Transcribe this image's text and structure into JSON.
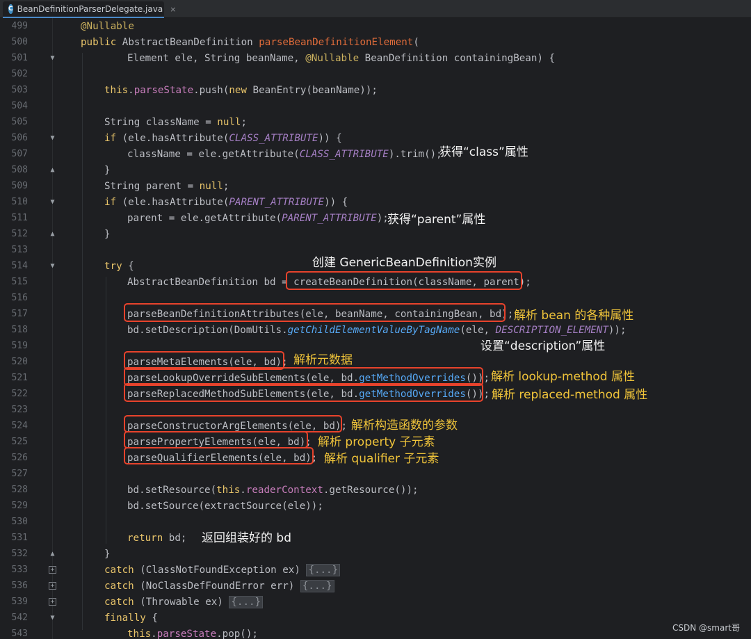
{
  "tab": {
    "icon": "java-class-icon",
    "icon_letter": "C",
    "filename": "BeanDefinitionParserDelegate.java",
    "close": "×"
  },
  "lines": [
    {
      "n": "499"
    },
    {
      "n": "500"
    },
    {
      "n": "501"
    },
    {
      "n": "502"
    },
    {
      "n": "503"
    },
    {
      "n": "504"
    },
    {
      "n": "505"
    },
    {
      "n": "506"
    },
    {
      "n": "507"
    },
    {
      "n": "508"
    },
    {
      "n": "509"
    },
    {
      "n": "510"
    },
    {
      "n": "511"
    },
    {
      "n": "512"
    },
    {
      "n": "513"
    },
    {
      "n": "514"
    },
    {
      "n": "515"
    },
    {
      "n": "516"
    },
    {
      "n": "517"
    },
    {
      "n": "518"
    },
    {
      "n": "519"
    },
    {
      "n": "520"
    },
    {
      "n": "521"
    },
    {
      "n": "522"
    },
    {
      "n": "523"
    },
    {
      "n": "524"
    },
    {
      "n": "525"
    },
    {
      "n": "526"
    },
    {
      "n": "527"
    },
    {
      "n": "528"
    },
    {
      "n": "529"
    },
    {
      "n": "530"
    },
    {
      "n": "531"
    },
    {
      "n": "532"
    },
    {
      "n": "533"
    },
    {
      "n": "536"
    },
    {
      "n": "539"
    },
    {
      "n": "542"
    },
    {
      "n": "543"
    }
  ],
  "code": {
    "l499": "@Nullable",
    "l500_kw": "public ",
    "l500_type": "AbstractBeanDefinition ",
    "l500_m": "parseBeanDefinitionElement",
    "l500_p": "(",
    "l501_a": "Element ele, String beanName, ",
    "l501_ann": "@Nullable",
    "l501_b": " BeanDefinition containingBean) {",
    "l503_kw": "this",
    "l503_a": ".",
    "l503_f": "parseState",
    "l503_b": ".push(",
    "l503_new": "new",
    "l503_c": " BeanEntry(beanName));",
    "l505_a": "String className = ",
    "l505_kw": "null",
    "l505_b": ";",
    "l506_kw": "if",
    "l506_a": " (ele.hasAttribute(",
    "l506_c": "CLASS_ATTRIBUTE",
    "l506_b": ")) {",
    "l507_a": "className = ele.getAttribute(",
    "l507_c": "CLASS_ATTRIBUTE",
    "l507_b": ").trim();",
    "l508": "}",
    "l509_a": "String parent = ",
    "l509_kw": "null",
    "l509_b": ";",
    "l510_kw": "if",
    "l510_a": " (ele.hasAttribute(",
    "l510_c": "PARENT_ATTRIBUTE",
    "l510_b": ")) {",
    "l511_a": "parent = ele.getAttribute(",
    "l511_c": "PARENT_ATTRIBUTE",
    "l511_b": ");",
    "l512": "}",
    "l514_kw": "try",
    "l514_a": " {",
    "l515_a": "AbstractBeanDefinition bd = ",
    "l515_b": "createBeanDefinition(className, parent);",
    "l517": "parseBeanDefinitionAttributes(ele, beanName, containingBean, bd);",
    "l518_a": "bd.setDescription(DomUtils.",
    "l518_s": "getChildElementValueByTagName",
    "l518_b": "(ele, ",
    "l518_c": "DESCRIPTION_ELEMENT",
    "l518_d": "));",
    "l520": "parseMetaElements(ele, bd);",
    "l521_a": "parseLookupOverrideSubElements(ele, bd.",
    "l521_f": "getMethodOverrides",
    "l521_b": "());",
    "l522_a": "parseReplacedMethodSubElements(ele, bd.",
    "l522_f": "getMethodOverrides",
    "l522_b": "());",
    "l524": "parseConstructorArgElements(ele, bd);",
    "l525": "parsePropertyElements(ele, bd);",
    "l526": "parseQualifierElements(ele, bd);",
    "l528_a": "bd.setResource(",
    "l528_kw": "this",
    "l528_b": ".",
    "l528_f": "readerContext",
    "l528_c": ".getResource());",
    "l529": "bd.setSource(extractSource(ele));",
    "l531_kw": "return",
    "l531_a": " bd;",
    "l532": "}",
    "l533_kw": "catch",
    "l533_a": " (ClassNotFoundException ex) ",
    "l533_fold": "{...}",
    "l536_kw": "catch",
    "l536_a": " (NoClassDefFoundError err) ",
    "l536_fold": "{...}",
    "l539_kw": "catch",
    "l539_a": " (Throwable ex) ",
    "l539_fold": "{...}",
    "l542_kw": "finally",
    "l542_a": " {",
    "l543_kw": "this",
    "l543_a": ".",
    "l543_f": "parseState",
    "l543_b": ".pop();"
  },
  "notes": {
    "class_attr": "获得“class”属性",
    "parent_attr": "获得“parent”属性",
    "create_instance": "创建 GenericBeanDefinition实例",
    "bean_attrs": "解析 bean 的各种属性",
    "description": "设置“description”属性",
    "meta": "解析元数据",
    "lookup": "解析 lookup-method 属性",
    "replaced": "解析 replaced-method 属性",
    "constructor": "解析构造函数的参数",
    "property": "解析 property 子元素",
    "qualifier": "解析 qualifier 子元素",
    "return_bd": "返回组装好的 bd"
  },
  "watermark": "CSDN @smart哥",
  "colors": {
    "highlight_box": "#e8432c",
    "note_yellow": "#f0c43a",
    "note_white": "#f2f2f2",
    "background": "#1e1f22"
  }
}
